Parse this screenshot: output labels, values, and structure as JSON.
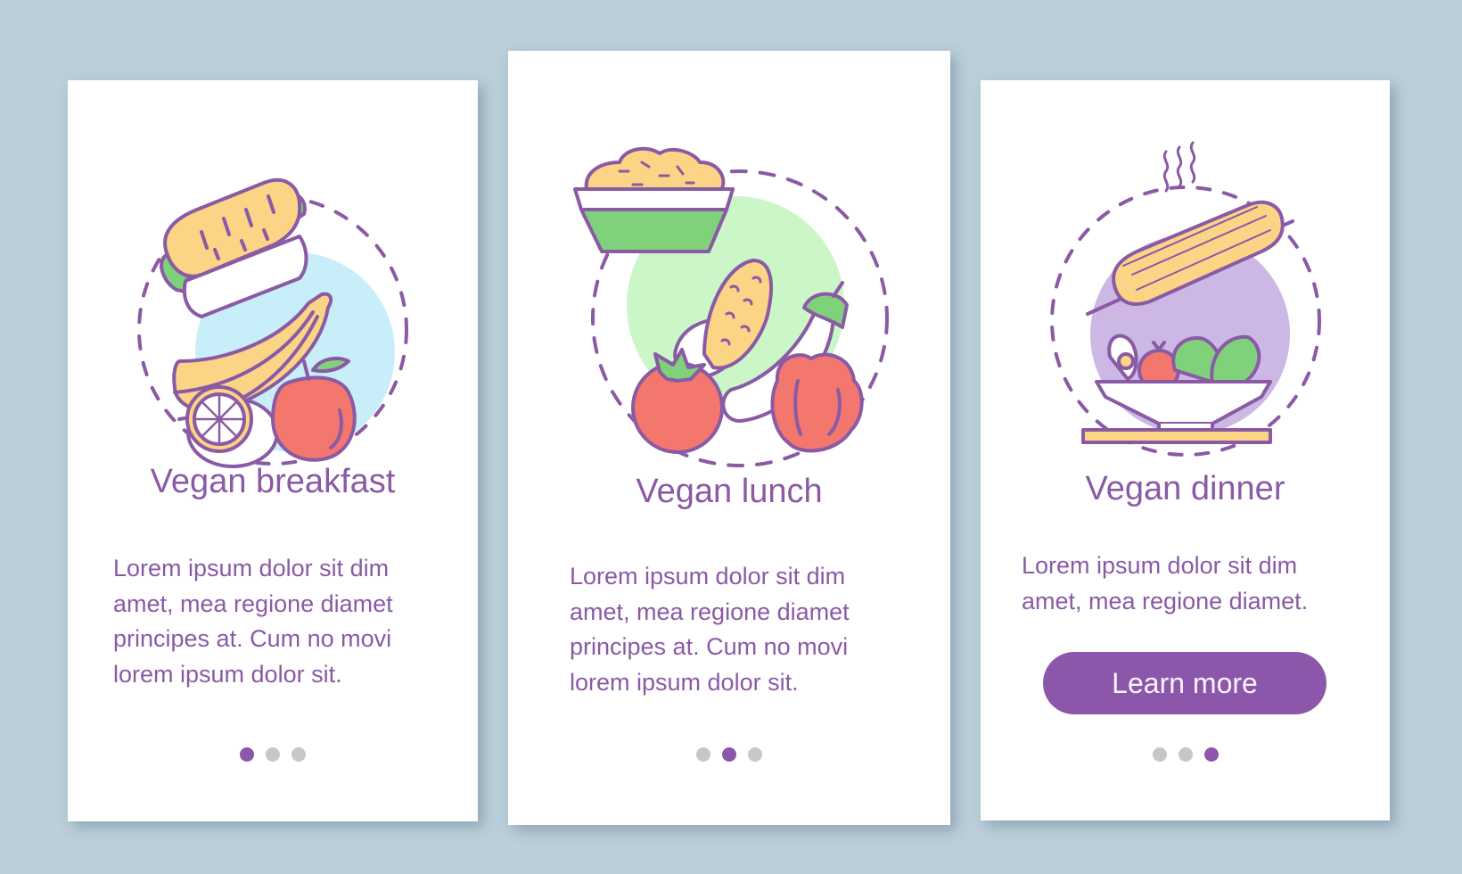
{
  "colors": {
    "background": "#bacfda",
    "accent": "#8c57ab",
    "text": "#8a5aa5",
    "dot_inactive": "#c7c7c7",
    "outline": "#8a5aa5",
    "yellow": "#fbd486",
    "green": "#7fd27a",
    "red": "#f4776e",
    "blue_circle": "#c8eef9",
    "green_circle": "#caf6c8",
    "purple_circle": "#cdb8e5"
  },
  "screens": [
    {
      "title": "Vegan breakfast",
      "body": "Lorem ipsum dolor sit dim\namet, mea regione diamet\nprincipes at. Cum no movi\nlorem ipsum dolor sit.",
      "illustration": "breakfast-illustration",
      "page_indicator": {
        "total": 3,
        "active": 1
      }
    },
    {
      "title": "Vegan lunch",
      "body": "Lorem ipsum dolor sit dim\namet, mea regione diamet\nprincipes at. Cum no movi\nlorem ipsum dolor sit.",
      "illustration": "lunch-illustration",
      "page_indicator": {
        "total": 3,
        "active": 2
      }
    },
    {
      "title": "Vegan dinner",
      "body": "Lorem ipsum dolor sit dim\namet, mea regione diamet.",
      "button_label": "Learn more",
      "illustration": "dinner-illustration",
      "page_indicator": {
        "total": 3,
        "active": 3
      }
    }
  ]
}
